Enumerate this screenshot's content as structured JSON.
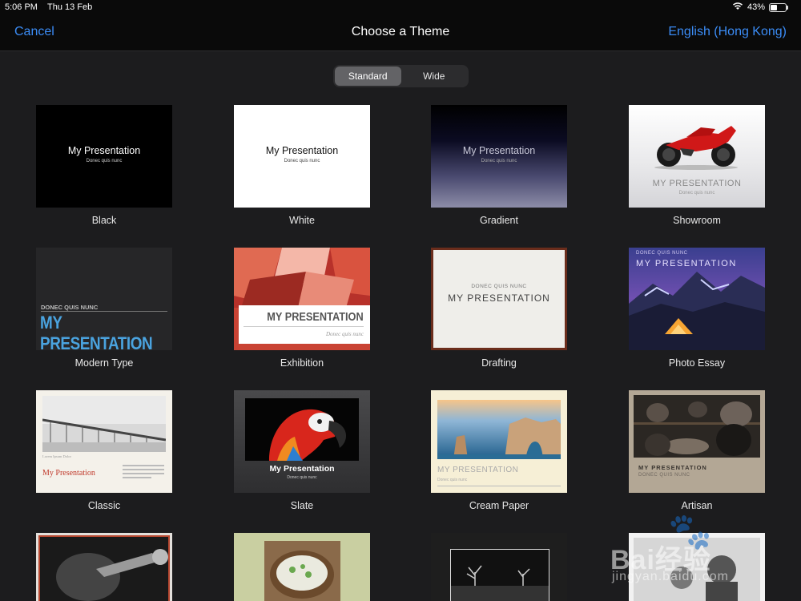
{
  "status_bar": {
    "time": "5:06 PM",
    "date": "Thu 13 Feb",
    "battery": "43%",
    "battery_level": 0.43
  },
  "nav": {
    "cancel": "Cancel",
    "title": "Choose a Theme",
    "language": "English (Hong Kong)"
  },
  "segmented": {
    "options": [
      "Standard",
      "Wide"
    ],
    "selected": "Standard"
  },
  "themes": [
    {
      "name": "Black",
      "title": "My Presentation",
      "subtitle": "Donec quis nunc"
    },
    {
      "name": "White",
      "title": "My Presentation",
      "subtitle": "Donec quis nunc"
    },
    {
      "name": "Gradient",
      "title": "My Presentation",
      "subtitle": "Donec quis nunc"
    },
    {
      "name": "Showroom",
      "title": "MY PRESENTATION",
      "subtitle": "Donec quis nunc"
    },
    {
      "name": "Modern Type",
      "title": "MY PRESENTATION",
      "subtitle": "DONEC QUIS NUNC"
    },
    {
      "name": "Exhibition",
      "title": "MY PRESENTATION",
      "subtitle": "Donec quis nunc"
    },
    {
      "name": "Drafting",
      "title": "MY PRESENTATION",
      "subtitle": "DONEC QUIS NUNC"
    },
    {
      "name": "Photo Essay",
      "title": "MY PRESENTATION",
      "subtitle": "DONEC QUIS NUNC"
    },
    {
      "name": "Classic",
      "title": "My Presentation",
      "subtitle": "Lorem Ipsum Dolor"
    },
    {
      "name": "Slate",
      "title": "My Presentation",
      "subtitle": "Donec quis nunc"
    },
    {
      "name": "Cream Paper",
      "title": "MY PRESENTATION",
      "subtitle": "Donec quis nunc"
    },
    {
      "name": "Artisan",
      "title": "MY PRESENTATION",
      "subtitle": "DONEC QUIS NUNC"
    }
  ],
  "watermark": {
    "brand": "Bai经验",
    "url": "jingyan.baidu.com"
  }
}
